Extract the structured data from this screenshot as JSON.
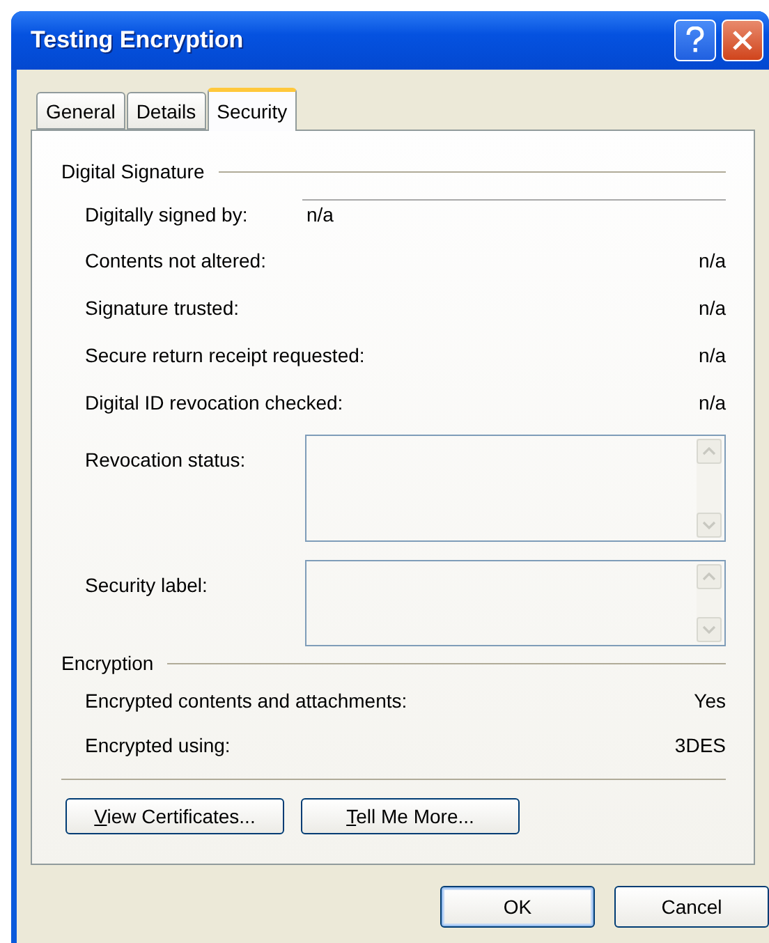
{
  "window": {
    "title": "Testing Encryption"
  },
  "tabs": [
    {
      "label": "General",
      "selected": false
    },
    {
      "label": "Details",
      "selected": false
    },
    {
      "label": "Security",
      "selected": true
    }
  ],
  "digital_signature": {
    "heading": "Digital Signature",
    "signed_by": {
      "label": "Digitally signed by:",
      "value": "n/a"
    },
    "rows": [
      {
        "label": "Contents not altered:",
        "value": "n/a"
      },
      {
        "label": "Signature trusted:",
        "value": "n/a"
      },
      {
        "label": "Secure return receipt requested:",
        "value": "n/a"
      },
      {
        "label": "Digital ID revocation checked:",
        "value": "n/a"
      }
    ],
    "boxes": [
      {
        "label": "Revocation status:",
        "kind": "tall"
      },
      {
        "label": "Security label:",
        "kind": "short"
      }
    ]
  },
  "encryption": {
    "heading": "Encryption",
    "rows": [
      {
        "label": "Encrypted contents and attachments:",
        "value": "Yes"
      },
      {
        "label": "Encrypted using:",
        "value": "3DES"
      }
    ]
  },
  "panel_buttons": [
    {
      "label": "View Certificates...",
      "mnemonic_underlined": true
    },
    {
      "label": "Tell Me More...",
      "mnemonic_underlined": true
    }
  ],
  "dialog_buttons": [
    {
      "label": "OK",
      "default": true
    },
    {
      "label": "Cancel",
      "default": false
    }
  ]
}
